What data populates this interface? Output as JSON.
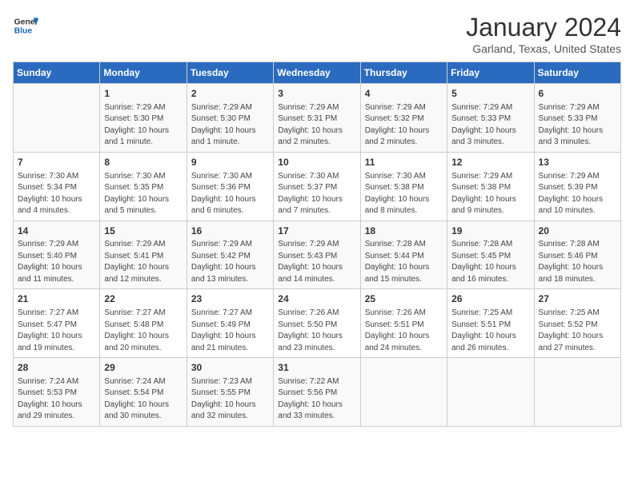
{
  "header": {
    "logo_general": "General",
    "logo_blue": "Blue",
    "month": "January 2024",
    "location": "Garland, Texas, United States"
  },
  "weekdays": [
    "Sunday",
    "Monday",
    "Tuesday",
    "Wednesday",
    "Thursday",
    "Friday",
    "Saturday"
  ],
  "weeks": [
    [
      {
        "day": "",
        "info": ""
      },
      {
        "day": "1",
        "info": "Sunrise: 7:29 AM\nSunset: 5:30 PM\nDaylight: 10 hours\nand 1 minute."
      },
      {
        "day": "2",
        "info": "Sunrise: 7:29 AM\nSunset: 5:30 PM\nDaylight: 10 hours\nand 1 minute."
      },
      {
        "day": "3",
        "info": "Sunrise: 7:29 AM\nSunset: 5:31 PM\nDaylight: 10 hours\nand 2 minutes."
      },
      {
        "day": "4",
        "info": "Sunrise: 7:29 AM\nSunset: 5:32 PM\nDaylight: 10 hours\nand 2 minutes."
      },
      {
        "day": "5",
        "info": "Sunrise: 7:29 AM\nSunset: 5:33 PM\nDaylight: 10 hours\nand 3 minutes."
      },
      {
        "day": "6",
        "info": "Sunrise: 7:29 AM\nSunset: 5:33 PM\nDaylight: 10 hours\nand 3 minutes."
      }
    ],
    [
      {
        "day": "7",
        "info": "Sunrise: 7:30 AM\nSunset: 5:34 PM\nDaylight: 10 hours\nand 4 minutes."
      },
      {
        "day": "8",
        "info": "Sunrise: 7:30 AM\nSunset: 5:35 PM\nDaylight: 10 hours\nand 5 minutes."
      },
      {
        "day": "9",
        "info": "Sunrise: 7:30 AM\nSunset: 5:36 PM\nDaylight: 10 hours\nand 6 minutes."
      },
      {
        "day": "10",
        "info": "Sunrise: 7:30 AM\nSunset: 5:37 PM\nDaylight: 10 hours\nand 7 minutes."
      },
      {
        "day": "11",
        "info": "Sunrise: 7:30 AM\nSunset: 5:38 PM\nDaylight: 10 hours\nand 8 minutes."
      },
      {
        "day": "12",
        "info": "Sunrise: 7:29 AM\nSunset: 5:38 PM\nDaylight: 10 hours\nand 9 minutes."
      },
      {
        "day": "13",
        "info": "Sunrise: 7:29 AM\nSunset: 5:39 PM\nDaylight: 10 hours\nand 10 minutes."
      }
    ],
    [
      {
        "day": "14",
        "info": "Sunrise: 7:29 AM\nSunset: 5:40 PM\nDaylight: 10 hours\nand 11 minutes."
      },
      {
        "day": "15",
        "info": "Sunrise: 7:29 AM\nSunset: 5:41 PM\nDaylight: 10 hours\nand 12 minutes."
      },
      {
        "day": "16",
        "info": "Sunrise: 7:29 AM\nSunset: 5:42 PM\nDaylight: 10 hours\nand 13 minutes."
      },
      {
        "day": "17",
        "info": "Sunrise: 7:29 AM\nSunset: 5:43 PM\nDaylight: 10 hours\nand 14 minutes."
      },
      {
        "day": "18",
        "info": "Sunrise: 7:28 AM\nSunset: 5:44 PM\nDaylight: 10 hours\nand 15 minutes."
      },
      {
        "day": "19",
        "info": "Sunrise: 7:28 AM\nSunset: 5:45 PM\nDaylight: 10 hours\nand 16 minutes."
      },
      {
        "day": "20",
        "info": "Sunrise: 7:28 AM\nSunset: 5:46 PM\nDaylight: 10 hours\nand 18 minutes."
      }
    ],
    [
      {
        "day": "21",
        "info": "Sunrise: 7:27 AM\nSunset: 5:47 PM\nDaylight: 10 hours\nand 19 minutes."
      },
      {
        "day": "22",
        "info": "Sunrise: 7:27 AM\nSunset: 5:48 PM\nDaylight: 10 hours\nand 20 minutes."
      },
      {
        "day": "23",
        "info": "Sunrise: 7:27 AM\nSunset: 5:49 PM\nDaylight: 10 hours\nand 21 minutes."
      },
      {
        "day": "24",
        "info": "Sunrise: 7:26 AM\nSunset: 5:50 PM\nDaylight: 10 hours\nand 23 minutes."
      },
      {
        "day": "25",
        "info": "Sunrise: 7:26 AM\nSunset: 5:51 PM\nDaylight: 10 hours\nand 24 minutes."
      },
      {
        "day": "26",
        "info": "Sunrise: 7:25 AM\nSunset: 5:51 PM\nDaylight: 10 hours\nand 26 minutes."
      },
      {
        "day": "27",
        "info": "Sunrise: 7:25 AM\nSunset: 5:52 PM\nDaylight: 10 hours\nand 27 minutes."
      }
    ],
    [
      {
        "day": "28",
        "info": "Sunrise: 7:24 AM\nSunset: 5:53 PM\nDaylight: 10 hours\nand 29 minutes."
      },
      {
        "day": "29",
        "info": "Sunrise: 7:24 AM\nSunset: 5:54 PM\nDaylight: 10 hours\nand 30 minutes."
      },
      {
        "day": "30",
        "info": "Sunrise: 7:23 AM\nSunset: 5:55 PM\nDaylight: 10 hours\nand 32 minutes."
      },
      {
        "day": "31",
        "info": "Sunrise: 7:22 AM\nSunset: 5:56 PM\nDaylight: 10 hours\nand 33 minutes."
      },
      {
        "day": "",
        "info": ""
      },
      {
        "day": "",
        "info": ""
      },
      {
        "day": "",
        "info": ""
      }
    ]
  ]
}
